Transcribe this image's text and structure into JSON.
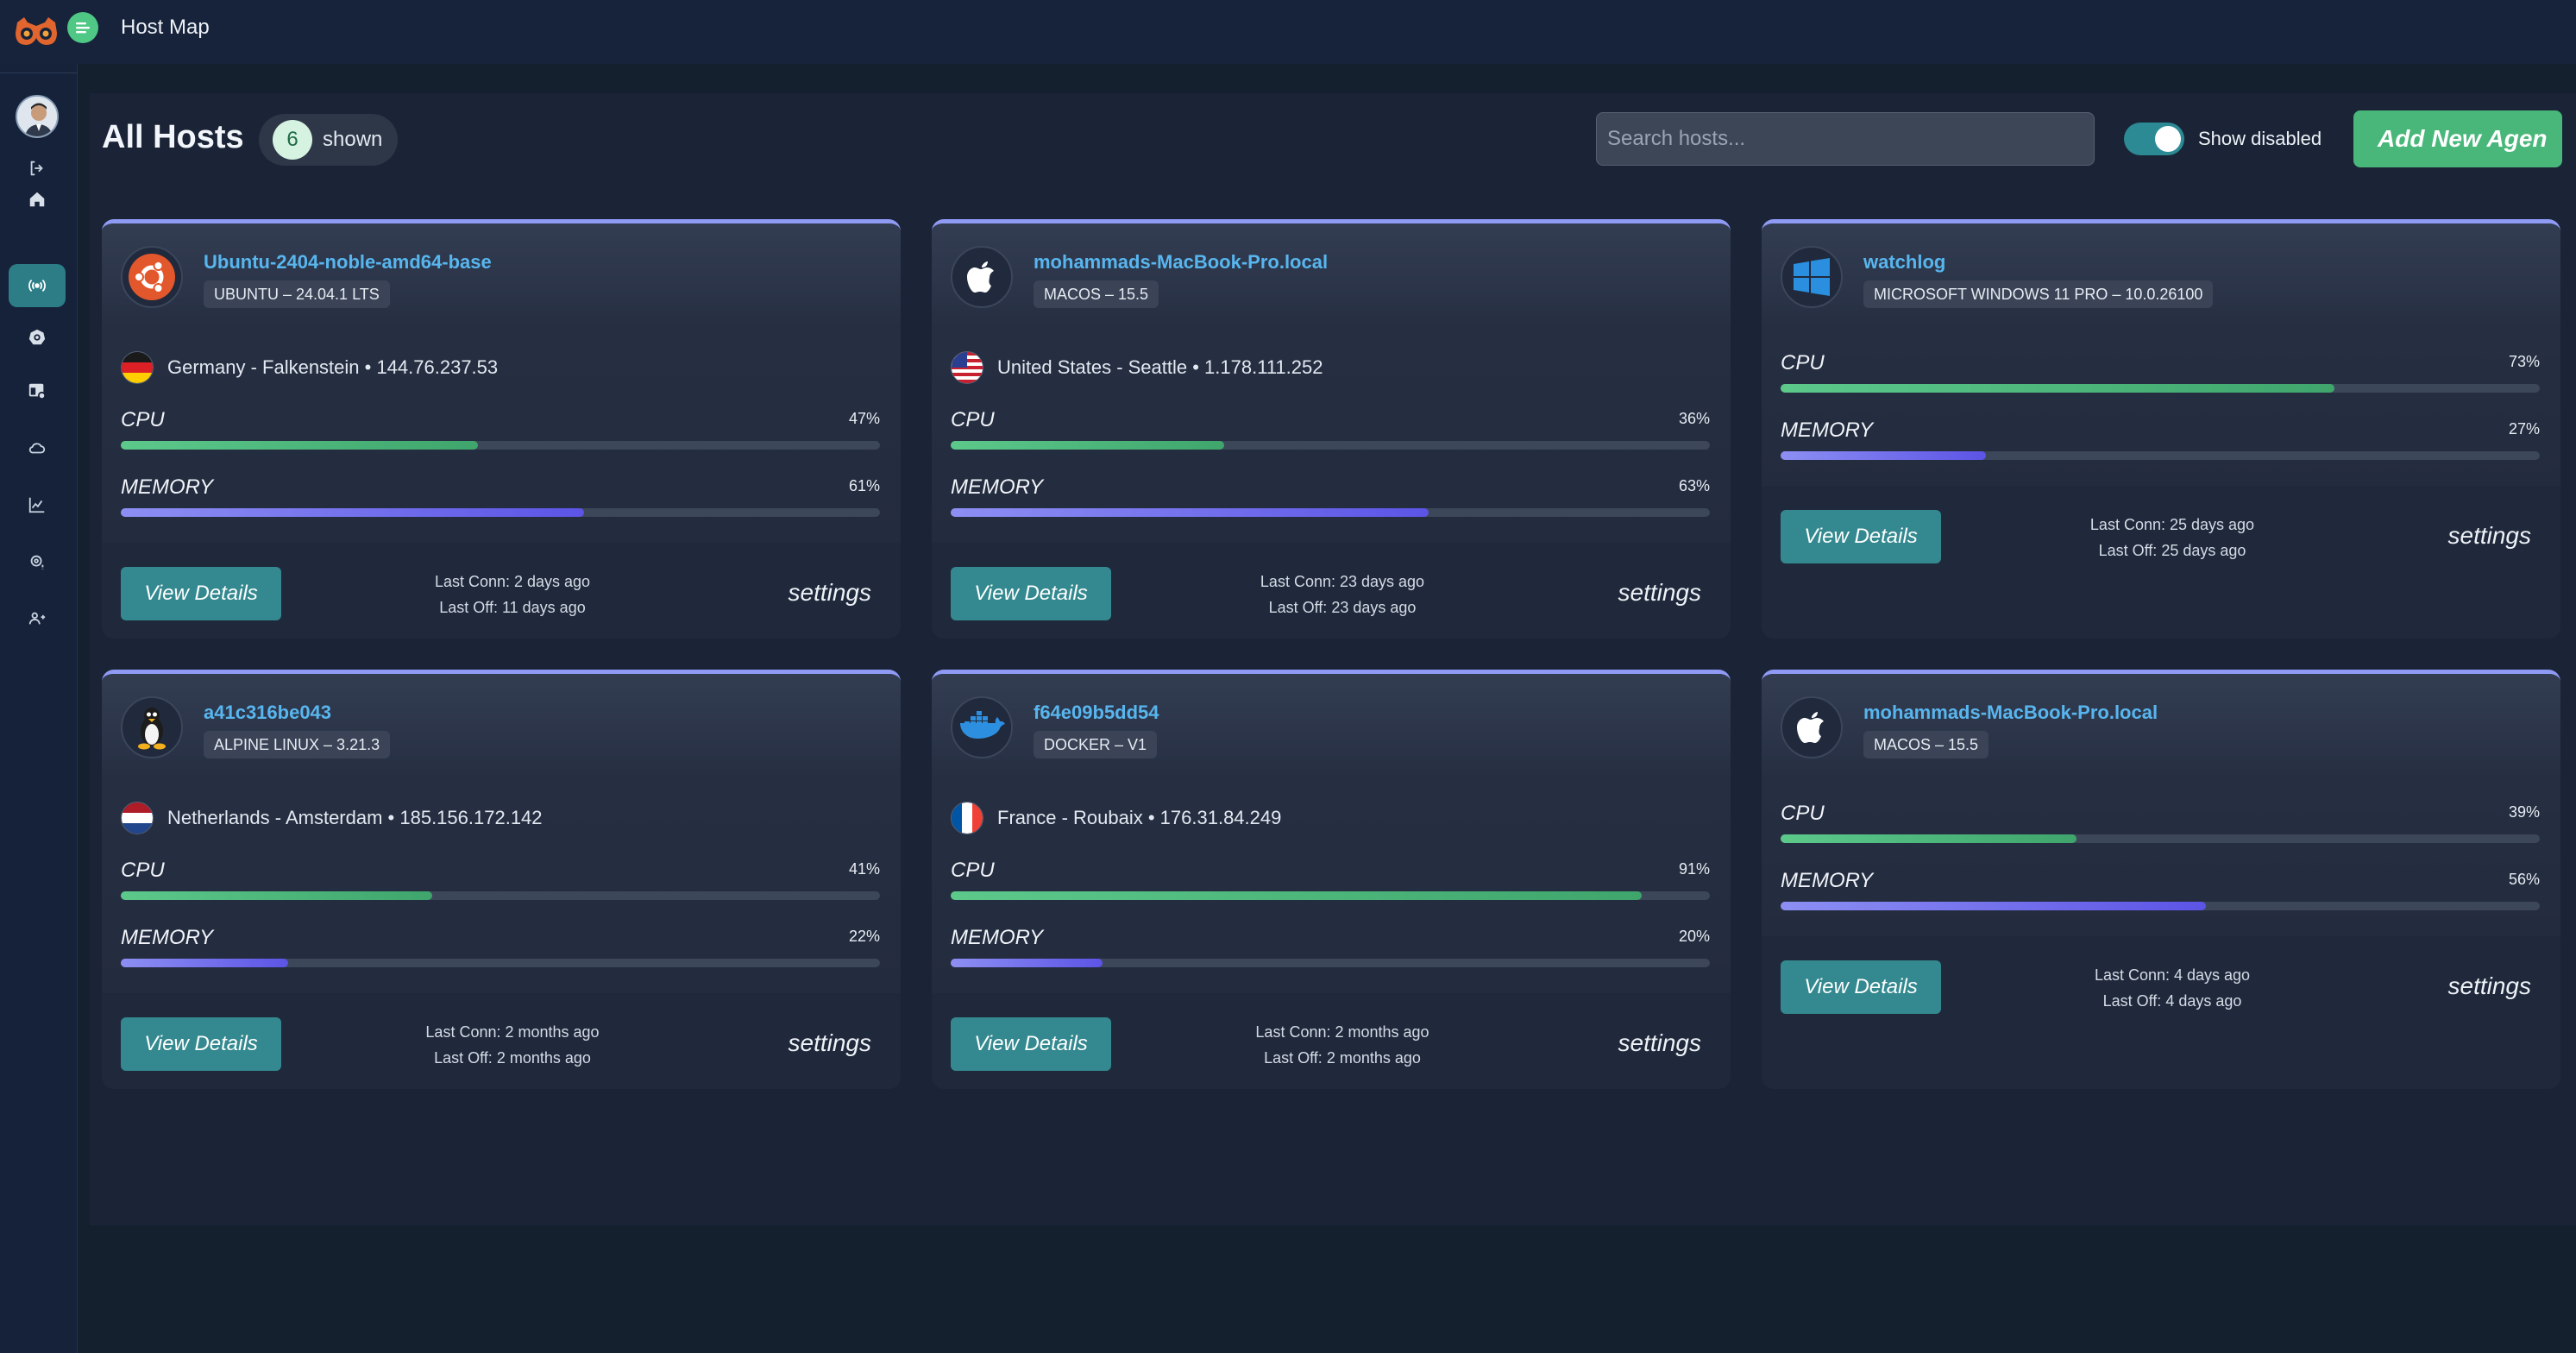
{
  "app": {
    "title": "Host Map"
  },
  "colors": {
    "accent": "#49b77a",
    "teal": "#33898f",
    "link": "#58b6ef",
    "cpu_bar": "#4fbf7f",
    "memory_bar": "#6b63ea",
    "card_top_border": "#8f9af5"
  },
  "sidebar": {
    "items": [
      {
        "icon": "signout-icon",
        "active": false
      },
      {
        "icon": "home-icon",
        "active": false
      },
      {
        "icon": "broadcast-icon",
        "active": true
      },
      {
        "icon": "kubernetes-icon",
        "active": false
      },
      {
        "icon": "dashboard-settings-icon",
        "active": false
      },
      {
        "icon": "cloud-icon",
        "active": false
      },
      {
        "icon": "chart-icon",
        "active": false
      },
      {
        "icon": "gear-alert-icon",
        "active": false
      },
      {
        "icon": "users-icon",
        "active": false
      }
    ]
  },
  "header": {
    "title": "All Hosts",
    "count": "6",
    "count_label": "shown",
    "search_placeholder": "Search hosts...",
    "toggle_label": "Show disabled",
    "toggle_on": true,
    "add_button": "Add New Agen"
  },
  "hosts": [
    {
      "name": "Ubuntu-2404-noble-amd64-base",
      "os": "UBUNTU – 24.04.1 LTS",
      "os_icon": "ubuntu-icon",
      "flag": "germany-flag-icon",
      "location": "Germany - Falkenstein • 144.76.237.53",
      "cpu": 47,
      "memory": 61,
      "cpu_text": "47%",
      "memory_text": "61%",
      "last_conn": "Last Conn: 2 days ago",
      "last_off": "Last Off: 11 days ago"
    },
    {
      "name": "mohammads-MacBook-Pro.local",
      "os": "MACOS – 15.5",
      "os_icon": "apple-icon",
      "flag": "usa-flag-icon",
      "location": "United States - Seattle • 1.178.111.252",
      "cpu": 36,
      "memory": 63,
      "cpu_text": "36%",
      "memory_text": "63%",
      "last_conn": "Last Conn: 23 days ago",
      "last_off": "Last Off: 23 days ago"
    },
    {
      "name": "watchlog",
      "os": "MICROSOFT WINDOWS 11 PRO – 10.0.26100",
      "os_icon": "windows-icon",
      "flag": null,
      "location": null,
      "cpu": 73,
      "memory": 27,
      "cpu_text": "73%",
      "memory_text": "27%",
      "last_conn": "Last Conn: 25 days ago",
      "last_off": "Last Off: 25 days ago"
    },
    {
      "name": "a41c316be043",
      "os": "ALPINE LINUX – 3.21.3",
      "os_icon": "linux-penguin-icon",
      "flag": "netherlands-flag-icon",
      "location": "Netherlands - Amsterdam • 185.156.172.142",
      "cpu": 41,
      "memory": 22,
      "cpu_text": "41%",
      "memory_text": "22%",
      "last_conn": "Last Conn: 2 months ago",
      "last_off": "Last Off: 2 months ago"
    },
    {
      "name": "f64e09b5dd54",
      "os": "DOCKER – V1",
      "os_icon": "docker-icon",
      "flag": "france-flag-icon",
      "location": "France - Roubaix • 176.31.84.249",
      "cpu": 91,
      "memory": 20,
      "cpu_text": "91%",
      "memory_text": "20%",
      "last_conn": "Last Conn: 2 months ago",
      "last_off": "Last Off: 2 months ago"
    },
    {
      "name": "mohammads-MacBook-Pro.local",
      "os": "MACOS – 15.5",
      "os_icon": "apple-icon",
      "flag": null,
      "location": null,
      "cpu": 39,
      "memory": 56,
      "cpu_text": "39%",
      "memory_text": "56%",
      "last_conn": "Last Conn: 4 days ago",
      "last_off": "Last Off: 4 days ago"
    }
  ],
  "labels": {
    "cpu": "CPU",
    "memory": "MEMORY",
    "view_details": "View Details",
    "settings": "settings"
  }
}
